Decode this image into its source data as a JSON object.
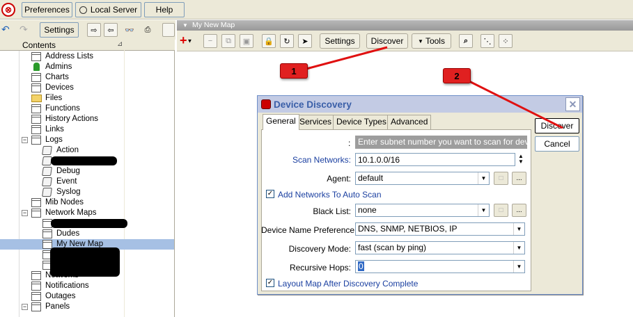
{
  "top_menu": {
    "preferences": "Preferences",
    "local_server": "Local Server",
    "help": "Help"
  },
  "left_toolbar": {
    "settings": "Settings"
  },
  "tree": {
    "header": "Contents",
    "items": [
      {
        "label": "Address Lists",
        "icon": "table-icon"
      },
      {
        "label": "Admins",
        "icon": "admin-icon"
      },
      {
        "label": "Charts",
        "icon": "table-icon"
      },
      {
        "label": "Devices",
        "icon": "table-icon"
      },
      {
        "label": "Files",
        "icon": "files-icon"
      },
      {
        "label": "Functions",
        "icon": "table-icon"
      },
      {
        "label": "History Actions",
        "icon": "table-icon"
      },
      {
        "label": "Links",
        "icon": "table-icon"
      },
      {
        "label": "Logs",
        "icon": "table-icon",
        "expander": "−"
      },
      {
        "label": "Action",
        "icon": "log-icon"
      },
      {
        "label": "",
        "icon": "log-icon",
        "redacted": true
      },
      {
        "label": "Debug",
        "icon": "log-icon"
      },
      {
        "label": "Event",
        "icon": "log-icon"
      },
      {
        "label": "Syslog",
        "icon": "log-icon"
      },
      {
        "label": "Mib Nodes",
        "icon": "table-icon"
      },
      {
        "label": "Network Maps",
        "icon": "table-icon",
        "expander": "−"
      },
      {
        "label": "",
        "icon": "table-icon",
        "redacted": true
      },
      {
        "label": "Dudes",
        "icon": "table-icon"
      },
      {
        "label": "My New Map",
        "icon": "table-icon",
        "selected": true
      },
      {
        "label": "",
        "icon": "table-icon",
        "redacted": true
      },
      {
        "label": "",
        "icon": "table-icon",
        "redacted": true
      },
      {
        "label": "Networks",
        "icon": "table-icon"
      },
      {
        "label": "Notifications",
        "icon": "table-icon"
      },
      {
        "label": "Outages",
        "icon": "table-icon"
      },
      {
        "label": "Panels",
        "icon": "table-icon",
        "expander": "−"
      }
    ]
  },
  "map_window": {
    "title": "My New Map",
    "settings": "Settings",
    "discover": "Discover",
    "tools": "Tools"
  },
  "callouts": {
    "one": "1",
    "two": "2"
  },
  "dialog": {
    "title": "Device Discovery",
    "close": "✕",
    "tabs": [
      "General",
      "Services",
      "Device Types",
      "Advanced"
    ],
    "hint": "Enter subnet number you want to scan for devices",
    "colon": ":",
    "scan_networks_label": "Scan Networks:",
    "scan_networks_value": "10.1.0.0/16",
    "agent_label": "Agent:",
    "agent_value": "default",
    "add_networks_label": "Add Networks To Auto Scan",
    "add_networks_checked": true,
    "black_list_label": "Black List:",
    "black_list_value": "none",
    "name_pref_label": "Device Name Preference:",
    "name_pref_value": "DNS, SNMP, NETBIOS, IP",
    "mode_label": "Discovery Mode:",
    "mode_value": "fast (scan by ping)",
    "hops_label": "Recursive Hops:",
    "hops_value": "0",
    "layout_label": "Layout Map After Discovery Complete",
    "layout_checked": true,
    "discover_btn": "Discover",
    "cancel_btn": "Cancel",
    "ellipsis": "...",
    "small_btn": "□"
  },
  "colors": {
    "selected_row": "#a6c0e4",
    "link_blue": "#1a3fa0",
    "dialog_title": "#3a5fa8",
    "callout_red": "#e02020"
  }
}
